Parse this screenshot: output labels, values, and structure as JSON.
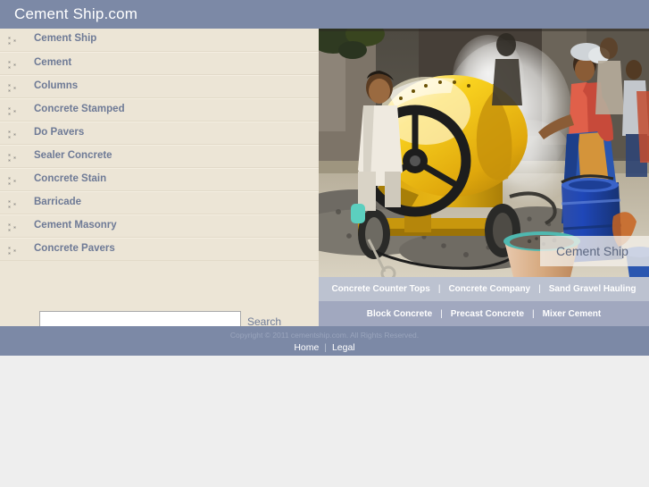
{
  "header": {
    "site_title": "Cement Ship.com",
    "bg_color": "#7c89a6"
  },
  "sidebar": {
    "bg_color": "#ece5d6",
    "bullet_icon": "three-dots-icon",
    "items": [
      {
        "label": "Cement Ship"
      },
      {
        "label": "Cement"
      },
      {
        "label": "Columns"
      },
      {
        "label": "Concrete Stamped"
      },
      {
        "label": "Do Pavers"
      },
      {
        "label": "Sealer Concrete"
      },
      {
        "label": "Concrete Stain"
      },
      {
        "label": "Barricade"
      },
      {
        "label": "Cement Masonry"
      },
      {
        "label": "Concrete Pavers"
      }
    ]
  },
  "search": {
    "value": "",
    "placeholder": "",
    "button_label": "Search"
  },
  "photo": {
    "caption": "Cement Ship",
    "alt": "cement-mixer-photo"
  },
  "keyword_bars": {
    "row1": {
      "bg_color": "#bcc2d0",
      "links": [
        "Concrete Counter Tops",
        "Concrete Company",
        "Sand Gravel Hauling"
      ],
      "separator": "|"
    },
    "row2": {
      "bg_color": "#a1a8bf",
      "links": [
        "Block Concrete",
        "Precast Concrete",
        "Mixer Cement"
      ],
      "separator": "|"
    }
  },
  "footer": {
    "bg_color": "#7c89a6",
    "copyright": "Copyright © 2011 cementship.com. All Rights Reserved.",
    "links": [
      "Home",
      "Legal"
    ],
    "separator": "|"
  }
}
